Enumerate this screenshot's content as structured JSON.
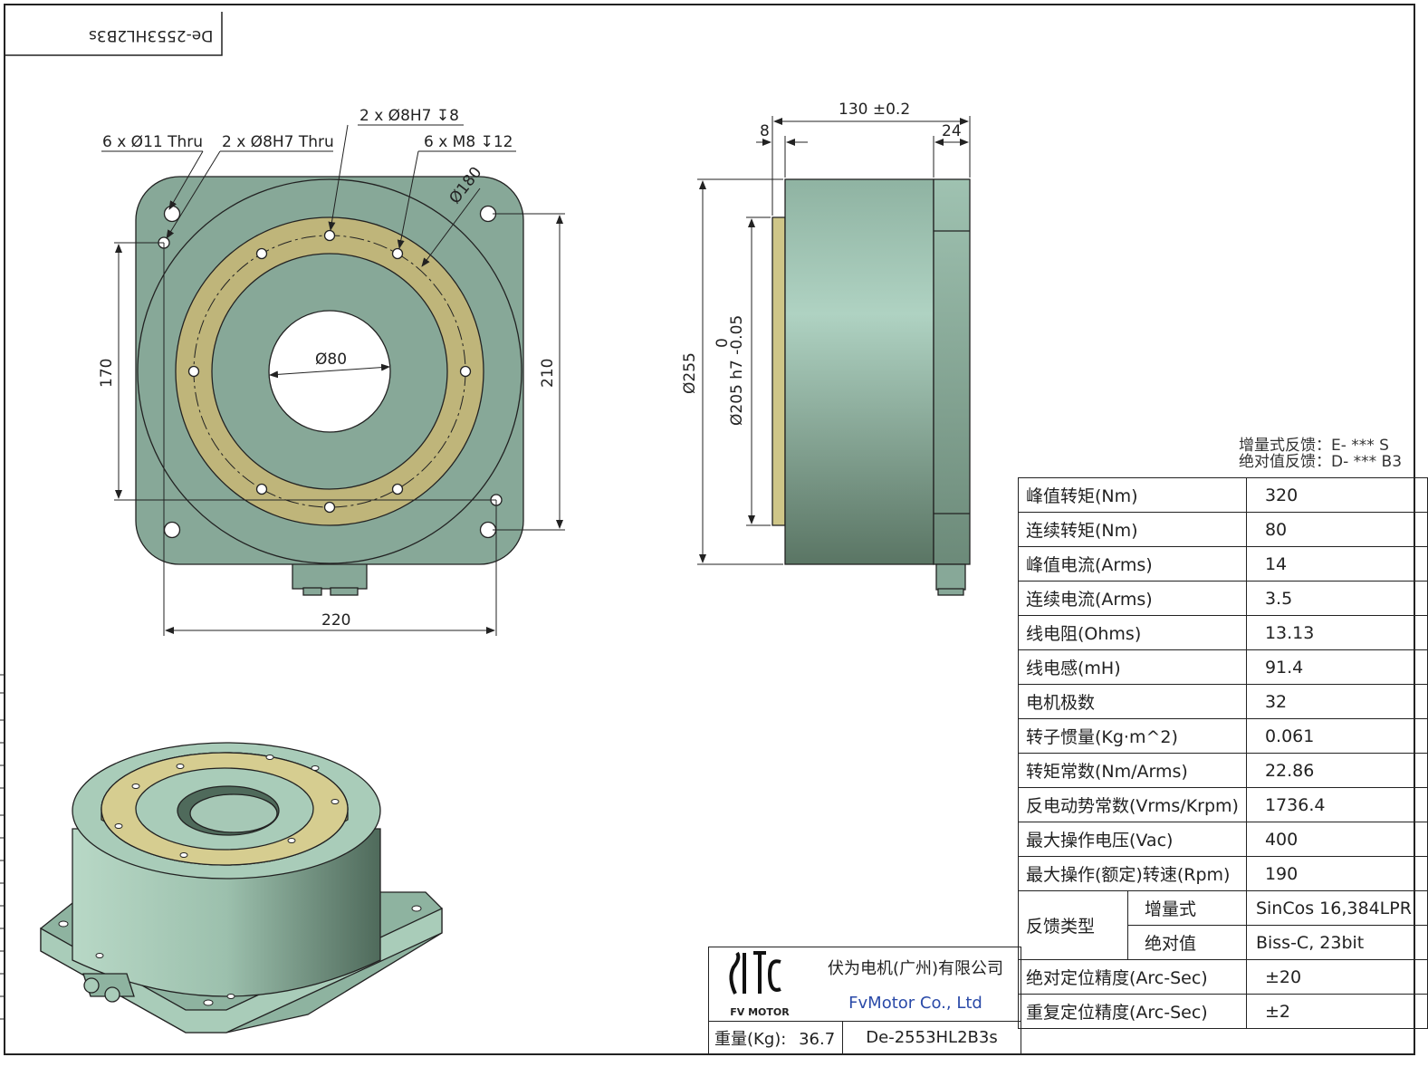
{
  "sheet": {
    "part_code_flipped": "De-2553HL2B3s"
  },
  "front_view": {
    "callout_holes_11": "6 x Ø11 Thru",
    "callout_pin_thru": "2 x Ø8H7 Thru",
    "callout_pin_depth": "2 x Ø8H7 ↧8",
    "callout_tapped": "6 x M8 ↧12",
    "dim_pcd": "Ø180",
    "dim_bore": "Ø80",
    "dim_170": "170",
    "dim_210": "210",
    "dim_220": "220"
  },
  "side_view": {
    "dim_length": "130 ±0.2",
    "dim_8": "8",
    "dim_24": "24",
    "dim_255": "Ø255",
    "dim_205": "Ø205 h7 -0.05",
    "dim_205_upper": "0"
  },
  "feedback_notes": {
    "incremental": "增量式反馈：E- *** S",
    "absolute": "绝对值反馈：D- *** B3"
  },
  "specs": {
    "rows": [
      {
        "label": "峰值转矩(Nm)",
        "value": "320"
      },
      {
        "label": "连续转矩(Nm)",
        "value": "80"
      },
      {
        "label": "峰值电流(Arms)",
        "value": "14"
      },
      {
        "label": "连续电流(Arms)",
        "value": "3.5"
      },
      {
        "label": "线电阻(Ohms)",
        "value": "13.13"
      },
      {
        "label": "线电感(mH)",
        "value": "91.4"
      },
      {
        "label": "电机极数",
        "value": "32"
      },
      {
        "label": "转子惯量(Kg·m^2)",
        "value": "0.061"
      },
      {
        "label": "转矩常数(Nm/Arms)",
        "value": "22.86"
      },
      {
        "label": "反电动势常数(Vrms/Krpm)",
        "value": "1736.4"
      },
      {
        "label": "最大操作电压(Vac)",
        "value": "400"
      },
      {
        "label": "最大操作(额定)转速(Rpm)",
        "value": "190"
      }
    ],
    "feedback_type_label": "反馈类型",
    "feedback_incremental_label": "增量式",
    "feedback_incremental_value": "SinCos 16,384LPR",
    "feedback_absolute_label": "绝对值",
    "feedback_absolute_value": "Biss-C, 23bit",
    "abs_accuracy_label": "绝对定位精度(Arc-Sec)",
    "abs_accuracy_value": "±20",
    "repeat_accuracy_label": "重复定位精度(Arc-Sec)",
    "repeat_accuracy_value": "±2"
  },
  "title_block": {
    "logo_text": "FV MOTOR",
    "company_cn": "伏为电机(广州)有限公司",
    "company_en": "FvMotor Co., Ltd",
    "weight_label": "重量(Kg):",
    "weight_value": "36.7",
    "part_number": "De-2553HL2B3s"
  },
  "colors": {
    "body_green": "#87a898",
    "ring_gold": "#bfb57a",
    "side_light": "#aacfbe",
    "side_dark": "#5c7867"
  }
}
